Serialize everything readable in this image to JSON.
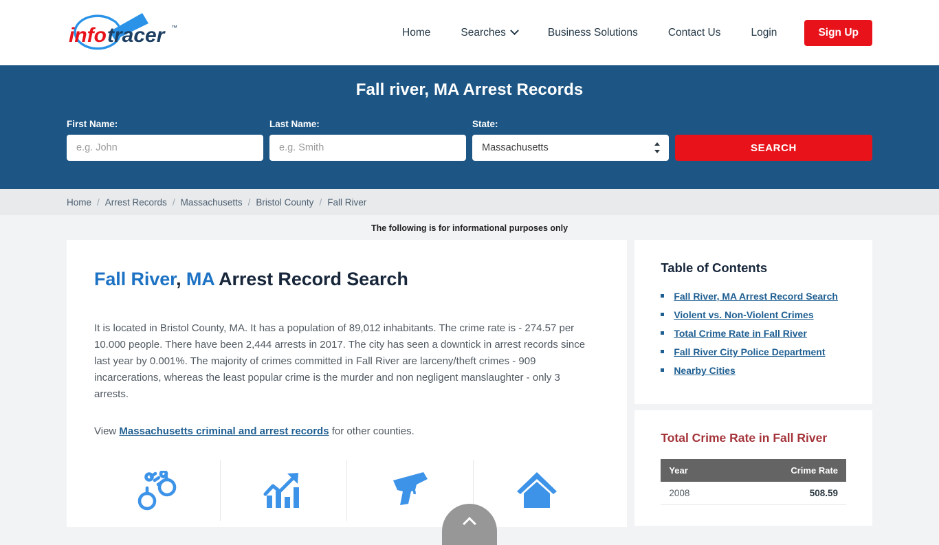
{
  "header": {
    "logo": {
      "part1": "info",
      "part2": "tracer",
      "tm": "™"
    },
    "nav": [
      {
        "label": "Home",
        "has_caret": false
      },
      {
        "label": "Searches",
        "has_caret": true
      },
      {
        "label": "Business Solutions",
        "has_caret": false
      },
      {
        "label": "Contact Us",
        "has_caret": false
      },
      {
        "label": "Login",
        "has_caret": false
      }
    ],
    "signup_label": "Sign Up"
  },
  "hero": {
    "title": "Fall river, MA Arrest Records",
    "first_name_label": "First Name:",
    "first_name_placeholder": "e.g. John",
    "first_name_value": "",
    "last_name_label": "Last Name:",
    "last_name_placeholder": "e.g. Smith",
    "last_name_value": "",
    "state_label": "State:",
    "state_value": "Massachusetts",
    "state_options": [
      "Massachusetts"
    ],
    "search_label": "SEARCH",
    "background": "#1d5685",
    "button_color": "#e8131a"
  },
  "breadcrumb": {
    "separator": "/",
    "items": [
      {
        "label": "Home",
        "current": false
      },
      {
        "label": "Arrest Records",
        "current": false
      },
      {
        "label": "Massachusetts",
        "current": false
      },
      {
        "label": "Bristol County",
        "current": false
      },
      {
        "label": "Fall River",
        "current": true
      }
    ]
  },
  "notice": "The following is for informational purposes only",
  "main": {
    "heading": {
      "city": "Fall River",
      "comma": ", ",
      "state": "MA",
      "rest": " Arrest Record Search"
    },
    "paragraph": "It is located in Bristol County, MA. It has a population of 89,012 inhabitants. The crime rate is - 274.57 per 10.000 people. There have been 2,444 arrests in 2017. The city has seen a downtick in arrest records since last year by 0.001%. The majority of crimes committed in Fall River are larceny/theft crimes - 909 incarcerations, whereas the least popular crime is the murder and non negligent manslaughter - only 3 arrests.",
    "view_prefix": "View ",
    "view_link": "Massachusetts criminal and arrest records",
    "view_suffix": " for other counties.",
    "icons": [
      {
        "name": "handcuffs-icon"
      },
      {
        "name": "growth-chart-icon"
      },
      {
        "name": "handgun-icon"
      },
      {
        "name": "house-icon"
      }
    ],
    "icon_color": "#3d93e8"
  },
  "sidebar": {
    "toc_title": "Table of Contents",
    "toc_items": [
      "Fall River, MA Arrest Record Search",
      "Violent vs. Non-Violent Crimes",
      "Total Crime Rate in Fall River",
      "Fall River City Police Department",
      "Nearby Cities"
    ],
    "crime_card_title": "Total Crime Rate in Fall River",
    "crime_table": {
      "columns": [
        "Year",
        "Crime Rate"
      ],
      "rows": [
        {
          "year": "2008",
          "rate": "508.59"
        }
      ]
    },
    "link_color": "#1f5f92",
    "crime_title_color": "#a4343a"
  },
  "scroll_top": {
    "name": "scroll-to-top",
    "glyph": "chevron-up"
  }
}
